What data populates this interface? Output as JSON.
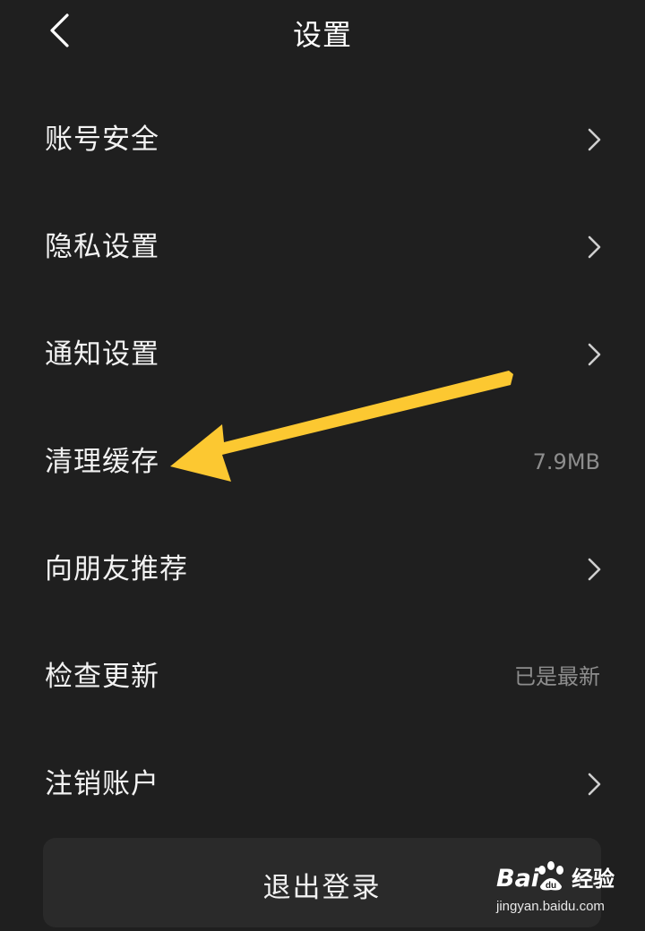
{
  "header": {
    "title": "设置",
    "back_icon": "chevron-left-icon"
  },
  "menu": {
    "items": [
      {
        "label": "账号安全",
        "trailing": "chevron-right-icon"
      },
      {
        "label": "隐私设置",
        "trailing": "chevron-right-icon"
      },
      {
        "label": "通知设置",
        "trailing": "chevron-right-icon"
      },
      {
        "label": "清理缓存",
        "value": "7.9MB"
      },
      {
        "label": "向朋友推荐",
        "trailing": "chevron-right-icon"
      },
      {
        "label": "检查更新",
        "value": "已是最新"
      },
      {
        "label": "注销账户",
        "trailing": "chevron-right-icon"
      }
    ]
  },
  "logout": {
    "label": "退出登录"
  },
  "annotation": {
    "arrow_color": "#fcc831",
    "points_to": "清理缓存"
  },
  "watermark": {
    "logo_text_left": "Bai",
    "logo_text_right": "经验",
    "url": "jingyan.baidu.com"
  },
  "colors": {
    "background": "#1f1f1f",
    "text": "#f2f2f2",
    "secondary_text": "#8d8d8d",
    "button_bg": "#2a2a2a"
  }
}
